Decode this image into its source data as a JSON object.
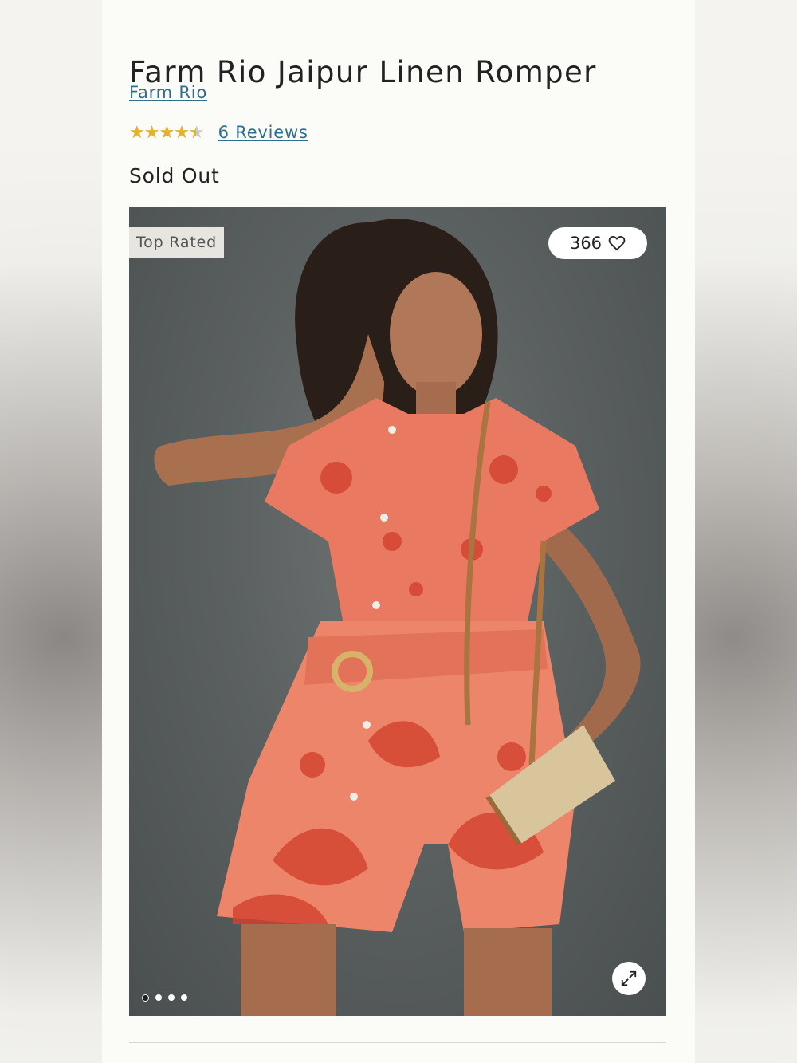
{
  "product": {
    "title": "Farm Rio Jaipur Linen Romper",
    "brand": "Farm Rio",
    "rating": 4.5,
    "rating_max": 5,
    "reviews_label": "6 Reviews",
    "status": "Sold Out"
  },
  "gallery": {
    "badge": "Top Rated",
    "favorites_count": "366",
    "slide_count": 4,
    "active_slide": 1,
    "icons": [
      "heart-icon",
      "expand-icon"
    ]
  },
  "colors": {
    "link": "#2f6f8a",
    "star": "#e3b32a",
    "romper": "#e97a61",
    "romper_pattern": "#d2412e"
  }
}
